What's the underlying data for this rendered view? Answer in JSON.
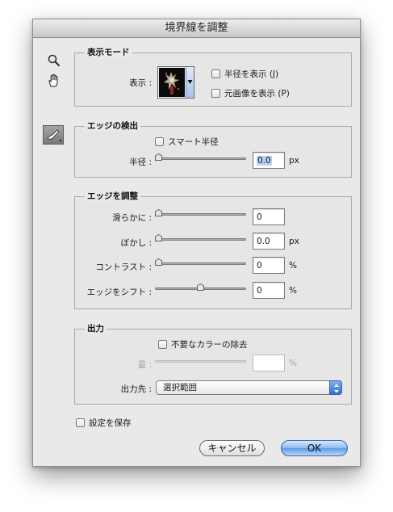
{
  "dialog": {
    "title": "境界線を調整"
  },
  "tools": {
    "zoom_icon": "magnifier",
    "hand_icon": "hand",
    "brush_icon": "refine-radius-brush"
  },
  "view_mode": {
    "legend": "表示モード",
    "view_label": "表示 :",
    "show_radius": {
      "label": "半径を表示 (J)",
      "checked": false
    },
    "show_original": {
      "label": "元画像を表示 (P)",
      "checked": false
    }
  },
  "edge_detection": {
    "legend": "エッジの検出",
    "smart_radius": {
      "label": "スマート半径",
      "checked": false
    },
    "radius_label": "半径 :",
    "radius_value": "0.0",
    "radius_unit": "px",
    "radius_slider_fraction": 0
  },
  "adjust_edge": {
    "legend": "エッジを調整",
    "smooth": {
      "label": "滑らかに :",
      "value": "0",
      "unit": "",
      "fraction": 0
    },
    "feather": {
      "label": "ぼかし :",
      "value": "0.0",
      "unit": "px",
      "fraction": 0
    },
    "contrast": {
      "label": "コントラスト :",
      "value": "0",
      "unit": "%",
      "fraction": 0
    },
    "shift_edge": {
      "label": "エッジをシフト :",
      "value": "0",
      "unit": "%",
      "fraction": 0.5
    }
  },
  "output": {
    "legend": "出力",
    "decontaminate": {
      "label": "不要なカラーの除去",
      "checked": false
    },
    "amount_label": "量 :",
    "amount_value": "",
    "amount_unit": "%",
    "output_to_label": "出力先 :",
    "output_to_value": "選択範囲"
  },
  "remember": {
    "label": "設定を保存",
    "checked": false
  },
  "buttons": {
    "cancel": "キャンセル",
    "ok": "OK"
  },
  "colors": {
    "accent": "#5f9be6",
    "dialog_bg": "#e9e9e9"
  }
}
